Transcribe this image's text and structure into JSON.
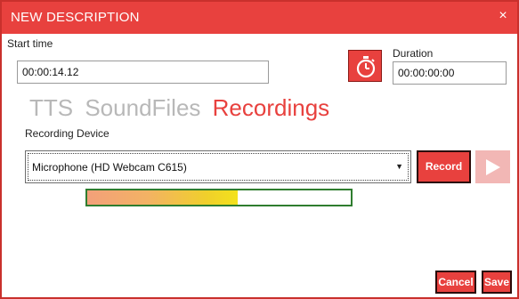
{
  "window": {
    "title": "NEW DESCRIPTION",
    "close_glyph": "×",
    "accent_color": "#e8413e"
  },
  "start_time": {
    "label": "Start time",
    "value": "00:00:14.12"
  },
  "timer_button": {
    "icon": "stopwatch-icon"
  },
  "duration": {
    "label": "Duration",
    "value": "00:00:00:00"
  },
  "tabs": [
    {
      "label": "TTS",
      "active": false
    },
    {
      "label": "SoundFiles",
      "active": false
    },
    {
      "label": "Recordings",
      "active": true
    }
  ],
  "recording": {
    "device_label": "Recording Device",
    "device_value": "Microphone (HD Webcam C615)",
    "dropdown_arrow": "▼",
    "record_label": "Record",
    "play_icon": "play-icon",
    "level_fraction": 0.57
  },
  "footer": {
    "cancel_label": "Cancel",
    "save_label": "Save"
  }
}
